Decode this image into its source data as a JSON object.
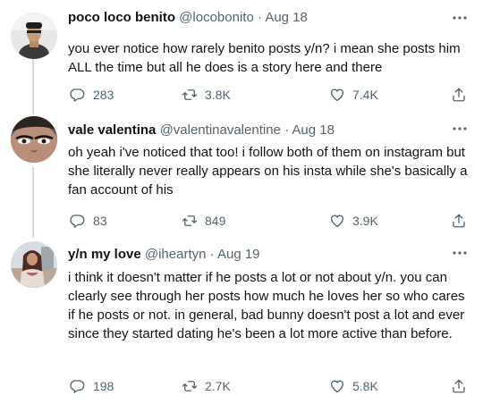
{
  "tweets": [
    {
      "name": "poco loco benito",
      "handle": "@locobonito",
      "separator": "·",
      "date": "Aug 18",
      "text": "you ever notice how rarely benito posts y/n? i mean she posts him ALL the time but all he does is a story here and there",
      "replies": "283",
      "retweets": "3.8K",
      "likes": "7.4K"
    },
    {
      "name": "vale valentina",
      "handle": "@valentinavalentine",
      "separator": "·",
      "date": "Aug 18",
      "text": "oh yeah i've noticed that too! i follow both of them on instagram but she literally never really appears on his insta while she's basically a fan account of his",
      "replies": "83",
      "retweets": "849",
      "likes": "3.9K"
    },
    {
      "name": "y/n my love",
      "handle": "@iheartyn",
      "separator": "·",
      "date": "Aug 19",
      "text": "i think it doesn't matter if he posts a lot or not about y/n. you can clearly see through her posts how much he loves her so who cares if he posts or not. in general, bad bunny doesn't post a lot and ever since they started dating he's been a lot more active than before.",
      "replies": "198",
      "retweets": "2.7K",
      "likes": "5.8K"
    }
  ],
  "icons": [
    "more-icon",
    "reply-icon",
    "retweet-icon",
    "like-icon",
    "share-icon"
  ],
  "colors": {
    "text": "#0f1419",
    "secondary": "#536471",
    "thread_line": "#cfd9de"
  }
}
